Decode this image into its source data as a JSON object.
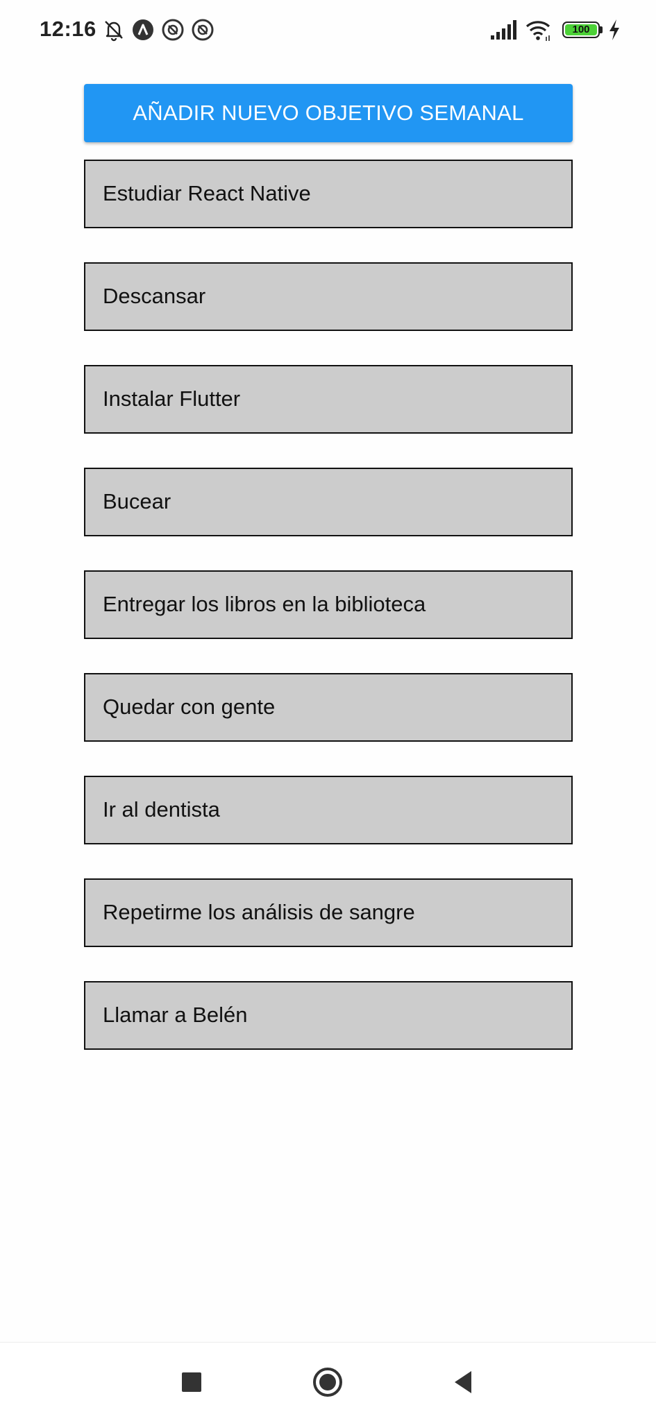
{
  "status_bar": {
    "time": "12:16",
    "battery_level": "100",
    "battery_fill_fraction": 1.0,
    "left_icons": [
      "bell-off-icon",
      "app-a-icon",
      "at-sign-icon",
      "at-sign-icon"
    ],
    "right_icons": [
      "signal-icon",
      "wifi-icon",
      "battery-icon",
      "charging-icon"
    ],
    "battery_color": "#4cd137"
  },
  "main": {
    "add_button_label": "AÑADIR NUEVO OBJETIVO SEMANAL",
    "accent_color": "#2196f3",
    "goals": [
      "Estudiar React Native",
      "Descansar",
      "Instalar Flutter",
      "Bucear",
      "Entregar los libros en la biblioteca",
      "Quedar con gente",
      "Ir al dentista",
      "Repetirme los análisis de sangre",
      "Llamar a Belén"
    ]
  },
  "nav_bar": {
    "buttons": [
      "recent-apps-icon",
      "home-icon",
      "back-icon"
    ]
  }
}
